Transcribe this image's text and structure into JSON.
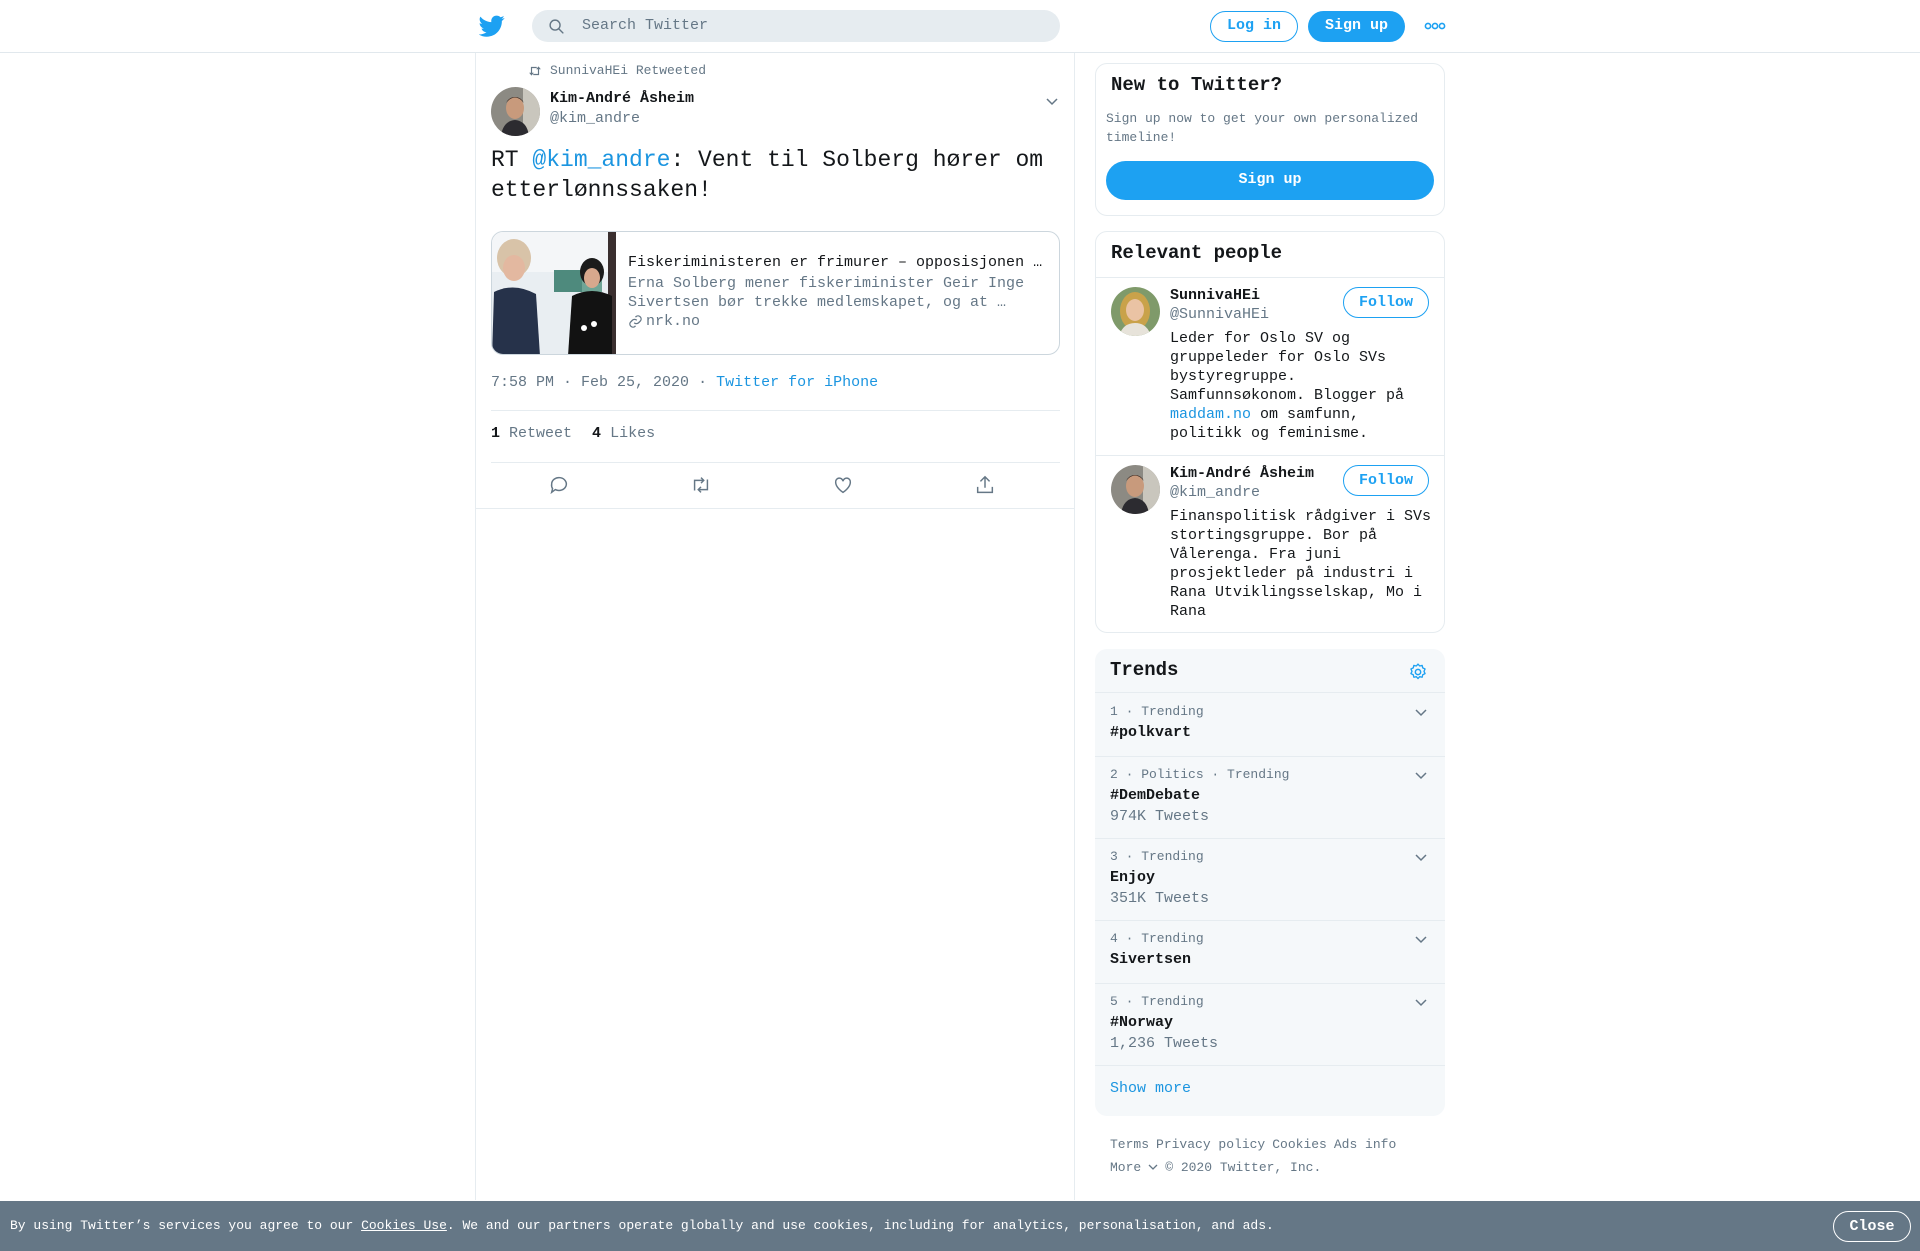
{
  "header": {
    "search_placeholder": "Search Twitter",
    "login_label": "Log in",
    "signup_label": "Sign up",
    "icons": [
      "twitter-bird-icon",
      "search-icon",
      "more-dots-icon"
    ]
  },
  "tweet": {
    "retweeted_by": "SunnivaHEi Retweeted",
    "author_name": "Kim-André Åsheim",
    "author_handle": "@kim_andre",
    "text_prefix": "RT ",
    "text_mention": "@kim_andre",
    "text_rest": ": Vent til Solberg hører om etterlønnssaken!",
    "card": {
      "title": "Fiskeriministeren er frimurer – opposisjonen …",
      "description": "Erna Solberg mener fiskeriminister Geir Inge Sivertsen bør trekke medlemskapet, og at …",
      "domain": "nrk.no"
    },
    "time": "7:58 PM · Feb 25, 2020",
    "separator": "·",
    "source": "Twitter for iPhone",
    "retweets_count": "1",
    "retweets_label": "Retweet",
    "likes_count": "4",
    "likes_label": "Likes",
    "action_icons": [
      "reply-icon",
      "retweet-icon",
      "like-icon",
      "share-icon"
    ]
  },
  "sidebar": {
    "new_to_twitter": {
      "title": "New to Twitter?",
      "description": "Sign up now to get your own personalized timeline!",
      "button": "Sign up"
    },
    "relevant_people": {
      "title": "Relevant people",
      "people": [
        {
          "name": "SunnivaHEi",
          "handle": "@SunnivaHEi",
          "follow": "Follow",
          "bio_before": "Leder for Oslo SV og gruppeleder for Oslo SVs bystyregruppe. Samfunnsøkonom. Blogger på ",
          "bio_link": "maddam.no",
          "bio_after": " om samfunn, politikk og feminisme."
        },
        {
          "name": "Kim-André Åsheim",
          "handle": "@kim_andre",
          "follow": "Follow",
          "bio": "Finanspolitisk rådgiver i SVs stortingsgruppe. Bor på Vålerenga. Fra juni prosjektleder på industri i Rana Utviklingsselskap, Mo i Rana"
        }
      ]
    },
    "trends": {
      "title": "Trends",
      "items": [
        {
          "context": "1 · Trending",
          "name": "#polkvart",
          "count": ""
        },
        {
          "context": "2 · Politics · Trending",
          "name": "#DemDebate",
          "count": "974K Tweets"
        },
        {
          "context": "3 · Trending",
          "name": "Enjoy",
          "count": "351K Tweets"
        },
        {
          "context": "4 · Trending",
          "name": "Sivertsen",
          "count": ""
        },
        {
          "context": "5 · Trending",
          "name": "#Norway",
          "count": "1,236 Tweets"
        }
      ],
      "show_more": "Show more"
    },
    "footer": {
      "links": [
        "Terms",
        "Privacy policy",
        "Cookies",
        "Ads info"
      ],
      "more": "More",
      "copyright": "© 2020 Twitter, Inc."
    }
  },
  "cookie_bar": {
    "text_before": "By using Twitter’s services you agree to our ",
    "link": "Cookies Use",
    "text_after": ". We and our partners operate globally and use cookies, including for analytics, personalisation, and ads.",
    "close": "Close"
  },
  "colors": {
    "accent": "#1da1f2",
    "link": "#1b95e0",
    "muted": "#657786",
    "cookie_bar": "#657786"
  }
}
